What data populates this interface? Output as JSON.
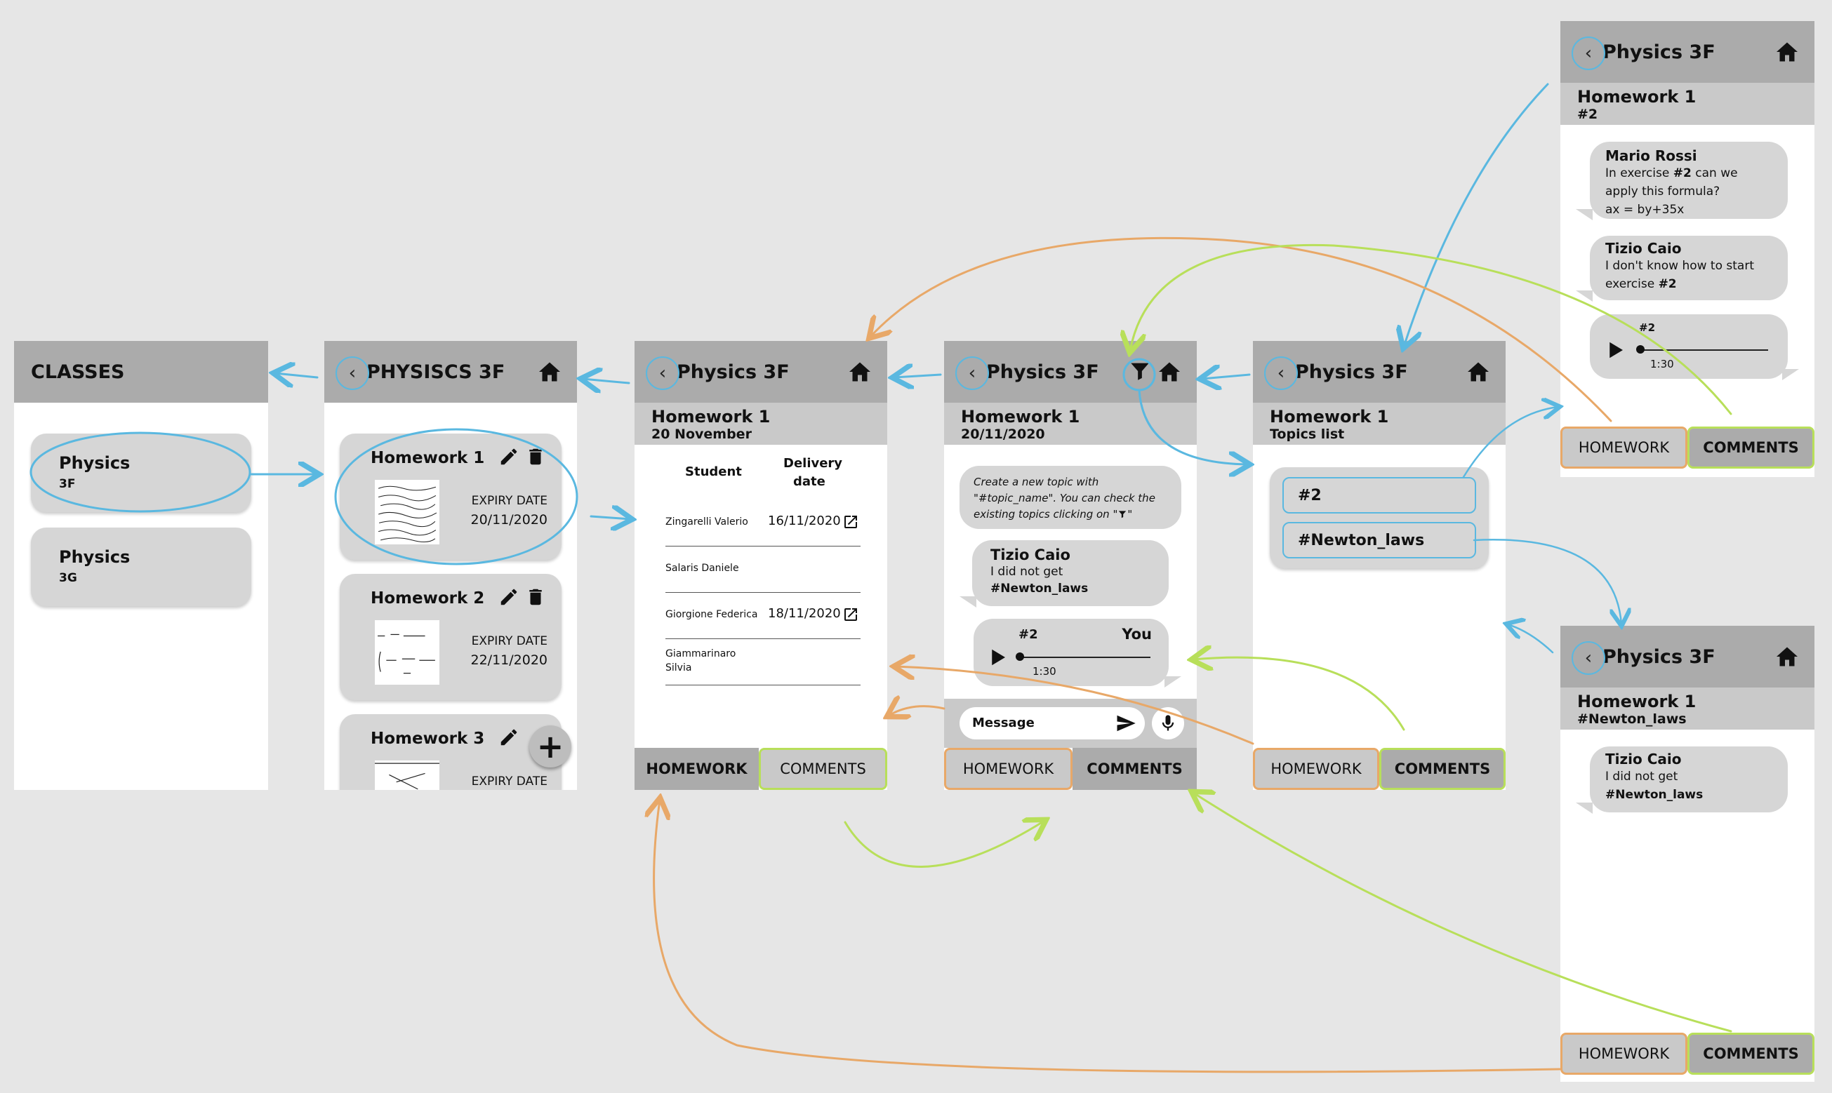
{
  "classes_screen": {
    "title": "CLASSES",
    "items": [
      {
        "name": "Physics",
        "section": "3F"
      },
      {
        "name": "Physics",
        "section": "3G"
      }
    ]
  },
  "class_screen": {
    "title": "PHYSISCS 3F",
    "homeworks": [
      {
        "title": "Homework 1",
        "expiry_label": "EXPIRY DATE",
        "expiry": "20/11/2020"
      },
      {
        "title": "Homework 2",
        "expiry_label": "EXPIRY DATE",
        "expiry": "22/11/2020"
      },
      {
        "title": "Homework 3",
        "expiry_label": "EXPIRY DATE",
        "expiry": ""
      }
    ],
    "fab": "+"
  },
  "homework_screen": {
    "title": "Physics  3F",
    "hw_title": "Homework 1",
    "hw_date": "20 November",
    "col_student": "Student",
    "col_delivery_1": "Delivery",
    "col_delivery_2": "date",
    "rows": [
      {
        "student": "Zingarelli Valerio",
        "date": "16/11/2020"
      },
      {
        "student": "Salaris Daniele",
        "date": ""
      },
      {
        "student": "Giorgione Federica",
        "date": "18/11/2020"
      },
      {
        "student_1": "Giammarinaro",
        "student_2": "Silvia",
        "date": ""
      }
    ],
    "tab_homework": "HOMEWORK",
    "tab_comments": "COMMENTS"
  },
  "comments_screen": {
    "title": "Physics  3F",
    "hw_title": "Homework 1",
    "hw_date": "20/11/2020",
    "hint_1": "Create a new topic with",
    "hint_2": "\"#topic_name\". You can check the",
    "hint_3": "existing topics clicking on \"",
    "hint_4": "\"",
    "msg_author": "Tizio Caio",
    "msg_line1": "I did not get",
    "msg_tag": "#Newton_laws",
    "audio_tag": "#2",
    "audio_author": "You",
    "audio_time": "1:30",
    "input_placeholder": "Message",
    "tab_homework": "HOMEWORK",
    "tab_comments": "COMMENTS"
  },
  "topics_screen": {
    "title": "Physics  3F",
    "hw_title": "Homework 1",
    "subtitle": "Topics list",
    "topics": [
      "#2",
      "#Newton_laws"
    ],
    "tab_homework": "HOMEWORK",
    "tab_comments": "COMMENTS"
  },
  "topic2_screen": {
    "title": "Physics  3F",
    "hw_title": "Homework 1",
    "topic": "#2",
    "msg1_author": "Mario Rossi",
    "msg1_l1a": "In exercise ",
    "msg1_l1b": "#2",
    "msg1_l1c": " can we",
    "msg1_l2": "apply this formula?",
    "msg1_l3": "ax = by+35x",
    "msg2_author": "Tizio Caio",
    "msg2_l1": "I don't know how to start",
    "msg2_l2a": "exercise ",
    "msg2_l2b": "#2",
    "audio_tag": "#2",
    "audio_time": "1:30",
    "tab_homework": "HOMEWORK",
    "tab_comments": "COMMENTS"
  },
  "newton_screen": {
    "title": "Physics  3F",
    "hw_title": "Homework 1",
    "topic": "#Newton_laws",
    "msg_author": "Tizio Caio",
    "msg_line1": "I did not get",
    "msg_tag": "#Newton_laws",
    "tab_homework": "HOMEWORK",
    "tab_comments": "COMMENTS"
  },
  "colors": {
    "header": "#ababab",
    "subheader": "#c9c9c9",
    "card": "#d6d6d6",
    "arrow_blue": "#5ab8e0",
    "arrow_orange": "#e8a868",
    "arrow_green": "#b8df5a"
  }
}
